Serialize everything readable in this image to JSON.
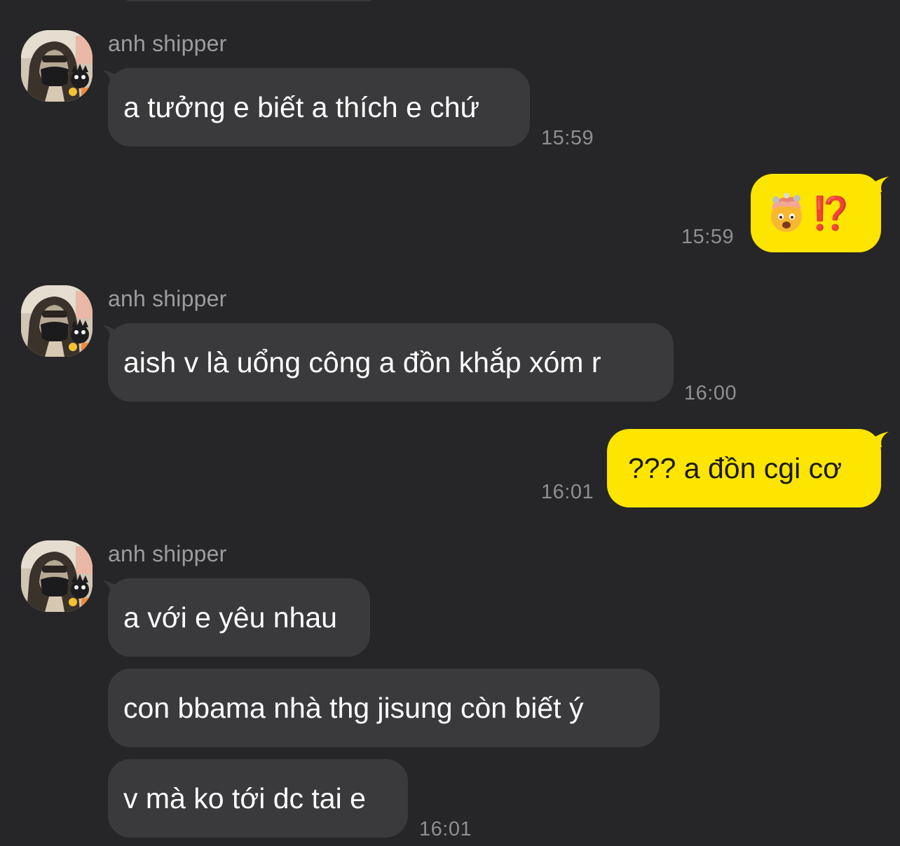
{
  "chat": {
    "messages": [
      {
        "sender": "anh shipper",
        "text": "a tưởng e biết a thích e chứ",
        "time": "15:59"
      },
      {
        "sender": "me",
        "text": "⁉️",
        "emoji": "exploding-head-emoji",
        "time": "15:59"
      },
      {
        "sender": "anh shipper",
        "text": "aish v là uổng công a đồn khắp xóm r",
        "time": "16:00"
      },
      {
        "sender": "me",
        "text": "??? a đồn cgi cơ",
        "time": "16:01"
      },
      {
        "sender": "anh shipper",
        "group": [
          "a với e yêu nhau",
          "con bbama nhà thg jisung còn biết ý",
          "v mà ko tới dc tai e"
        ],
        "time": "16:01"
      }
    ]
  },
  "colors": {
    "background": "#262628",
    "incoming_bubble": "#3a3a3c",
    "outgoing_bubble": "#fee500",
    "timestamp": "#8e8e93",
    "sender_name": "#9c9ca0"
  }
}
